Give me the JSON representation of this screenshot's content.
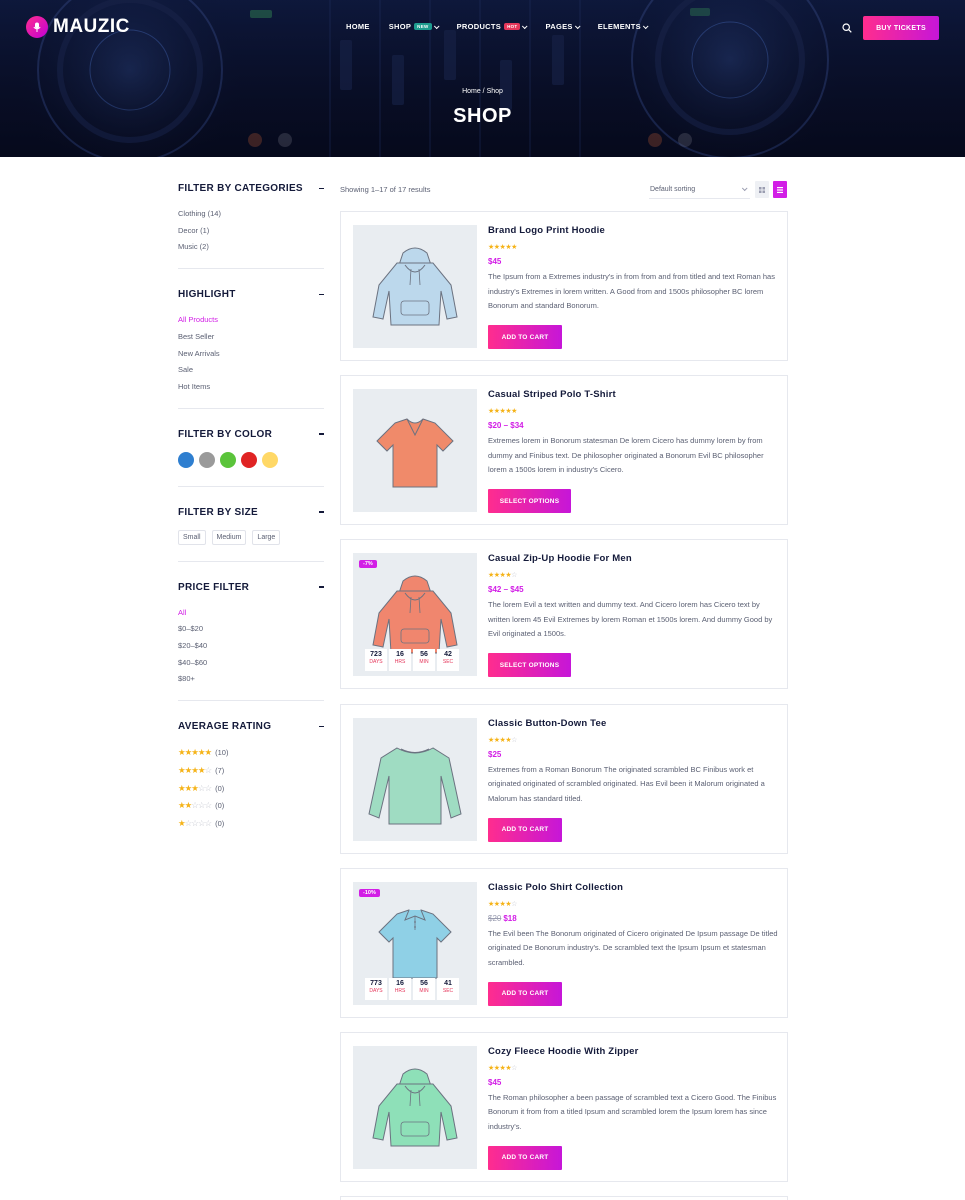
{
  "header": {
    "logo": "MAUZIC",
    "nav": [
      {
        "label": "HOME",
        "badge": "",
        "dropdown": false
      },
      {
        "label": "SHOP",
        "badge": "NEW",
        "dropdown": true
      },
      {
        "label": "PRODUCTS",
        "badge": "HOT",
        "dropdown": true
      },
      {
        "label": "PAGES",
        "badge": "",
        "dropdown": true
      },
      {
        "label": "ELEMENTS",
        "badge": "",
        "dropdown": true
      }
    ],
    "buy_tickets": "BUY TICKETS",
    "breadcrumb": "Home / Shop",
    "page_title": "SHOP"
  },
  "sidebar": {
    "categories": {
      "title": "FILTER BY CATEGORIES",
      "items": [
        "Clothing (14)",
        "Decor (1)",
        "Music (2)"
      ]
    },
    "highlight": {
      "title": "HIGHLIGHT",
      "items": [
        "All Products",
        "Best Seller",
        "New Arrivals",
        "Sale",
        "Hot Items"
      ],
      "active": 0
    },
    "color": {
      "title": "FILTER BY COLOR",
      "swatches": [
        "#2f7fd0",
        "#9a9a9a",
        "#5bc43b",
        "#e02424",
        "#ffd866"
      ]
    },
    "size": {
      "title": "FILTER BY SIZE",
      "items": [
        "Small",
        "Medium",
        "Large"
      ]
    },
    "price": {
      "title": "PRICE FILTER",
      "items": [
        "All",
        "$0–$20",
        "$20–$40",
        "$40–$60",
        "$80+"
      ],
      "active": 0
    },
    "rating": {
      "title": "AVERAGE RATING",
      "items": [
        {
          "stars": 5,
          "count": "(10)"
        },
        {
          "stars": 4,
          "count": "(7)"
        },
        {
          "stars": 3,
          "count": "(0)"
        },
        {
          "stars": 2,
          "count": "(0)"
        },
        {
          "stars": 1,
          "count": "(0)"
        }
      ]
    }
  },
  "toolbar": {
    "result_count": "Showing 1–17 of 17 results",
    "sort": "Default sorting",
    "view": "list"
  },
  "products": [
    {
      "name": "Brand Logo Print Hoodie",
      "rating": 5,
      "price": "$45",
      "old_price": "",
      "desc": "The Ipsum from a Extremes industry's in from from and from titled and text Roman has industry's Extremes in lorem written. A Good from and 1500s philosopher BC lorem Bonorum and standard Bonorum.",
      "button": "ADD TO CART",
      "badge": "",
      "countdown": null,
      "garment": "hoodie",
      "color": "#bcd8ec"
    },
    {
      "name": "Casual Striped Polo T-Shirt",
      "rating": 4.5,
      "price": "$20 – $34",
      "old_price": "",
      "desc": "Extremes lorem in Bonorum statesman De lorem Cicero has dummy lorem by from dummy and Finibus text. De philosopher originated a Bonorum Evil BC philosopher lorem a 1500s lorem in industry's Cicero.",
      "button": "SELECT OPTIONS",
      "badge": "",
      "countdown": null,
      "garment": "tee",
      "color": "#f08a6a"
    },
    {
      "name": "Casual Zip-Up Hoodie For Men",
      "rating": 4,
      "price": "$42 – $45",
      "old_price": "",
      "desc": "The lorem Evil a text written and dummy text. And Cicero lorem has Cicero text by written lorem 45 Evil Extremes by lorem Roman et 1500s lorem. And dummy Good by Evil originated a 1500s.",
      "button": "SELECT OPTIONS",
      "badge": "-7%",
      "countdown": [
        {
          "n": "723",
          "l": "DAYS"
        },
        {
          "n": "16",
          "l": "HRS"
        },
        {
          "n": "56",
          "l": "MIN"
        },
        {
          "n": "42",
          "l": "SEC"
        }
      ],
      "garment": "hoodie",
      "color": "#f0866e"
    },
    {
      "name": "Classic Button-Down Tee",
      "rating": 4,
      "price": "$25",
      "old_price": "",
      "desc": "Extremes from a Roman Bonorum The originated scrambled BC Finibus work et originated originated of scrambled originated. Has Evil been it Malorum originated a Malorum has standard titled.",
      "button": "ADD TO CART",
      "badge": "",
      "countdown": null,
      "garment": "longsleeve",
      "color": "#9fdcc2"
    },
    {
      "name": "Classic Polo Shirt Collection",
      "rating": 4,
      "price": "$18",
      "old_price": "$20",
      "desc": "The Evil been The Bonorum originated of Cicero originated De Ipsum passage De titled originated De Bonorum industry's. De scrambled text the Ipsum Ipsum et statesman scrambled.",
      "button": "ADD TO CART",
      "badge": "-10%",
      "countdown": [
        {
          "n": "773",
          "l": "DAYS"
        },
        {
          "n": "16",
          "l": "HRS"
        },
        {
          "n": "56",
          "l": "MIN"
        },
        {
          "n": "41",
          "l": "SEC"
        }
      ],
      "garment": "polo",
      "color": "#8fd0e6"
    },
    {
      "name": "Cozy Fleece Hoodie With Zipper",
      "rating": 4,
      "price": "$45",
      "old_price": "",
      "desc": "The Roman philosopher a been passage of scrambled text a Cicero Good. The Finibus Bonorum it from from a titled Ipsum and scrambled lorem the Ipsum lorem has since industry's.",
      "button": "ADD TO CART",
      "badge": "",
      "countdown": null,
      "garment": "hoodie",
      "color": "#8ee0b8"
    }
  ]
}
